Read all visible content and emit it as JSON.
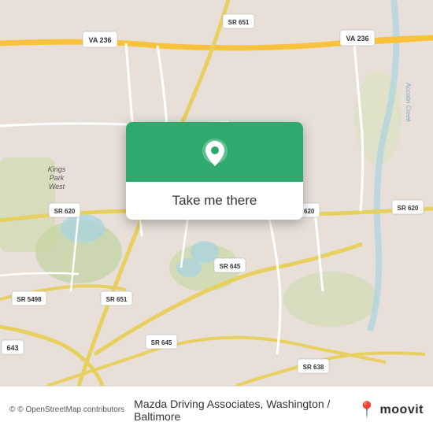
{
  "map": {
    "attribution": "© OpenStreetMap contributors",
    "accent_color": "#2eaa6e",
    "road_color_major": "#f9c23c",
    "road_color_minor": "#ffffff",
    "road_color_sr": "#d4c97e",
    "bg_color": "#e8e0d8",
    "water_color": "#aad3df",
    "green_color": "#c8d8a8"
  },
  "popup": {
    "label": "Take me there",
    "pin_icon": "location-pin"
  },
  "labels": {
    "va236_north": "VA 236",
    "va236_east": "VA 236",
    "sr651_top": "SR 651",
    "sr651_mid": "SR 651",
    "sr620_left": "SR 620",
    "sr620_right1": "SR 620",
    "sr620_right2": "SR 620",
    "sr645_mid": "SR 645",
    "sr645_bot": "SR 645",
    "sr638": "SR 638",
    "sr5498": "SR 5498",
    "r643": "643",
    "accotin_creek": "Accotin Creek",
    "kings_park_west": "Kings Park West"
  },
  "bottom_bar": {
    "attribution": "© OpenStreetMap contributors",
    "title": "Mazda Driving Associates, Washington / Baltimore",
    "moovit_text": "moovit"
  }
}
